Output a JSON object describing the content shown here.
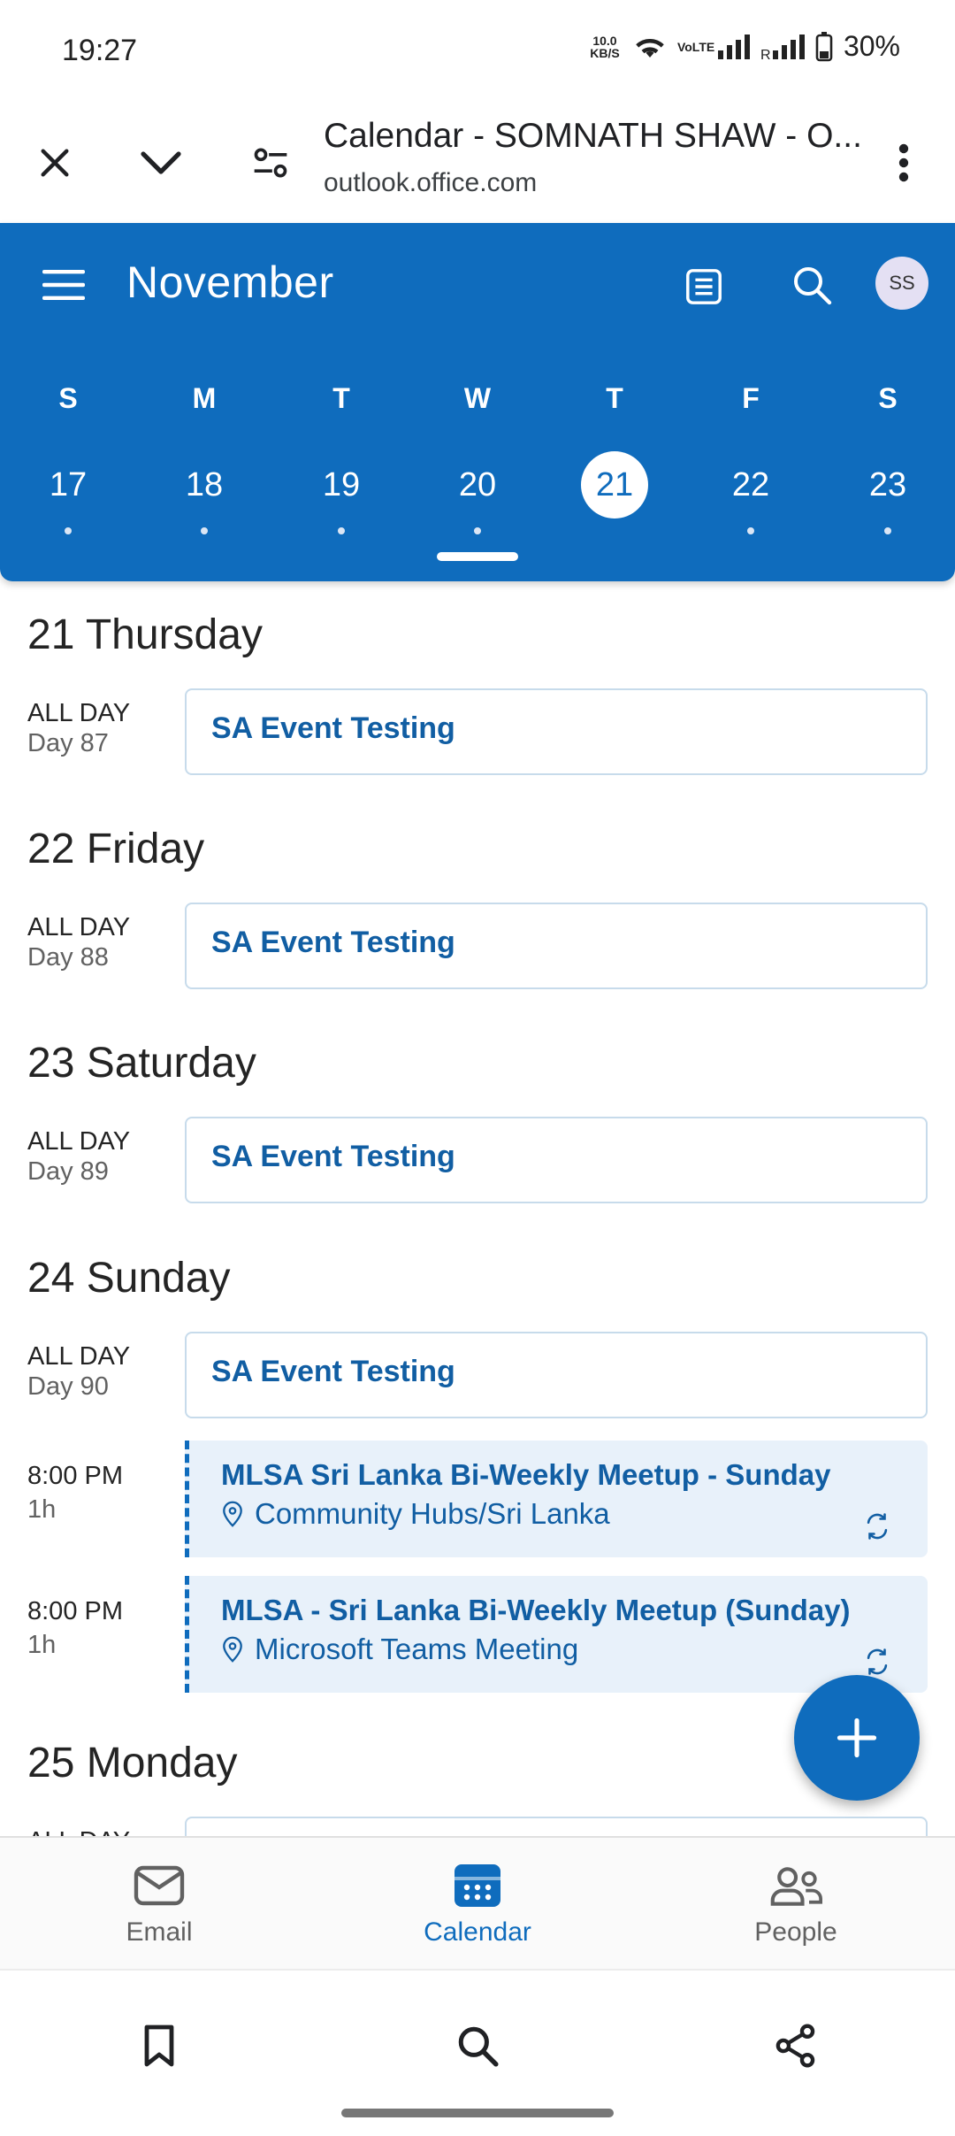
{
  "status_bar": {
    "time": "19:27",
    "net_speed": "10.0 KB/S",
    "volte": "VoLTE",
    "battery": "30%"
  },
  "browser": {
    "page_title": "Calendar - SOMNATH SHAW - O...",
    "url": "outlook.office.com"
  },
  "header": {
    "month": "November",
    "avatar_initials": "SS",
    "accent": "#0f6cbd"
  },
  "week": {
    "days_of_week": [
      "S",
      "M",
      "T",
      "W",
      "T",
      "F",
      "S"
    ],
    "dates": [
      "17",
      "18",
      "19",
      "20",
      "21",
      "22",
      "23"
    ],
    "selected_date": "21"
  },
  "agenda": {
    "days": [
      {
        "heading": "21 Thursday",
        "events": [
          {
            "kind": "all-day",
            "time": "ALL DAY",
            "sub": "Day 87",
            "title": "SA Event Testing"
          }
        ]
      },
      {
        "heading": "22 Friday",
        "events": [
          {
            "kind": "all-day",
            "time": "ALL DAY",
            "sub": "Day 88",
            "title": "SA Event Testing"
          }
        ]
      },
      {
        "heading": "23 Saturday",
        "events": [
          {
            "kind": "all-day",
            "time": "ALL DAY",
            "sub": "Day 89",
            "title": "SA Event Testing"
          }
        ]
      },
      {
        "heading": "24 Sunday",
        "events": [
          {
            "kind": "all-day",
            "time": "ALL DAY",
            "sub": "Day 90",
            "title": "SA Event Testing"
          },
          {
            "kind": "timed",
            "time": "8:00 PM",
            "sub": "1h",
            "title": "MLSA Sri Lanka Bi-Weekly Meetup - Sunday",
            "location": "Community Hubs/Sri Lanka"
          },
          {
            "kind": "timed",
            "time": "8:00 PM",
            "sub": "1h",
            "title": "MLSA - Sri Lanka Bi-Weekly Meetup (Sunday)",
            "location": "Microsoft Teams Meeting"
          }
        ]
      },
      {
        "heading": "25 Monday",
        "events": [
          {
            "kind": "all-day",
            "time": "ALL DAY",
            "sub": "",
            "title": ""
          }
        ]
      }
    ]
  },
  "bottom_nav": {
    "email": "Email",
    "calendar": "Calendar",
    "people": "People"
  },
  "icons": {
    "close": "close-icon",
    "collapse": "chevron-down-icon",
    "site_settings": "tune-icon",
    "more": "more-vertical-icon",
    "menu": "hamburger-icon",
    "agenda_view": "list-view-icon",
    "search": "search-icon",
    "new_event": "plus-icon",
    "bookmark": "bookmark-icon",
    "share": "share-icon"
  }
}
